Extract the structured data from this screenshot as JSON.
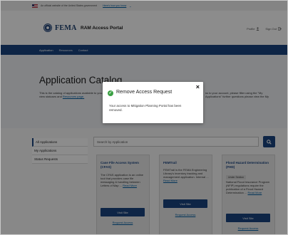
{
  "gov_banner": {
    "text": "An official website of the United States government",
    "link": "Here's how you know",
    "chevron": "⌄"
  },
  "header": {
    "logo_text": "FEMA",
    "portal_title": "RAM Access Portal",
    "profile_label": "Profile",
    "signout_label": "Sign Out"
  },
  "nav": {
    "items": [
      "Application",
      "Resources",
      "Contact"
    ]
  },
  "hero": {
    "title": "Application Catalog",
    "desc_left": "This is the catalog of applications available to you. To view statuses and",
    "desc_link": "Resources page.",
    "desc_right": "ss to your account, please filter using the \"My Applications\" further questions please view the My"
  },
  "sidebar": {
    "items": [
      "All Applications",
      "My Applications",
      "Status Requests"
    ]
  },
  "search": {
    "placeholder": "Search by Application"
  },
  "cards": [
    {
      "title": "Case File Access System (CFAS)",
      "body": "The CFAS application is an online tool that provides case file messaging & handling between Letters of Map ...",
      "more": "Read More",
      "button": "Visit Site",
      "link": "Request Access"
    },
    {
      "title": "FEMTrail",
      "body": "FEMTrail is the FEMA Engineering Library's inventory tracking and management application. Internal ...",
      "more": "Read More",
      "button": "Visit Site",
      "link": "Request Access"
    },
    {
      "title": "Flood Hazard Determination (FHD)",
      "tag": "Under Section",
      "body": "National Flood Insurance Program (NFIP) regulations require the publication of a Flood Hazard Determination ...",
      "more": "Read More",
      "button": "Visit Site",
      "link": "Request Access"
    }
  ],
  "modal": {
    "title": "Remove Access Request",
    "close": "×",
    "check": "✓",
    "message": "Your access to Mitigation Planning Portal has been removed."
  }
}
